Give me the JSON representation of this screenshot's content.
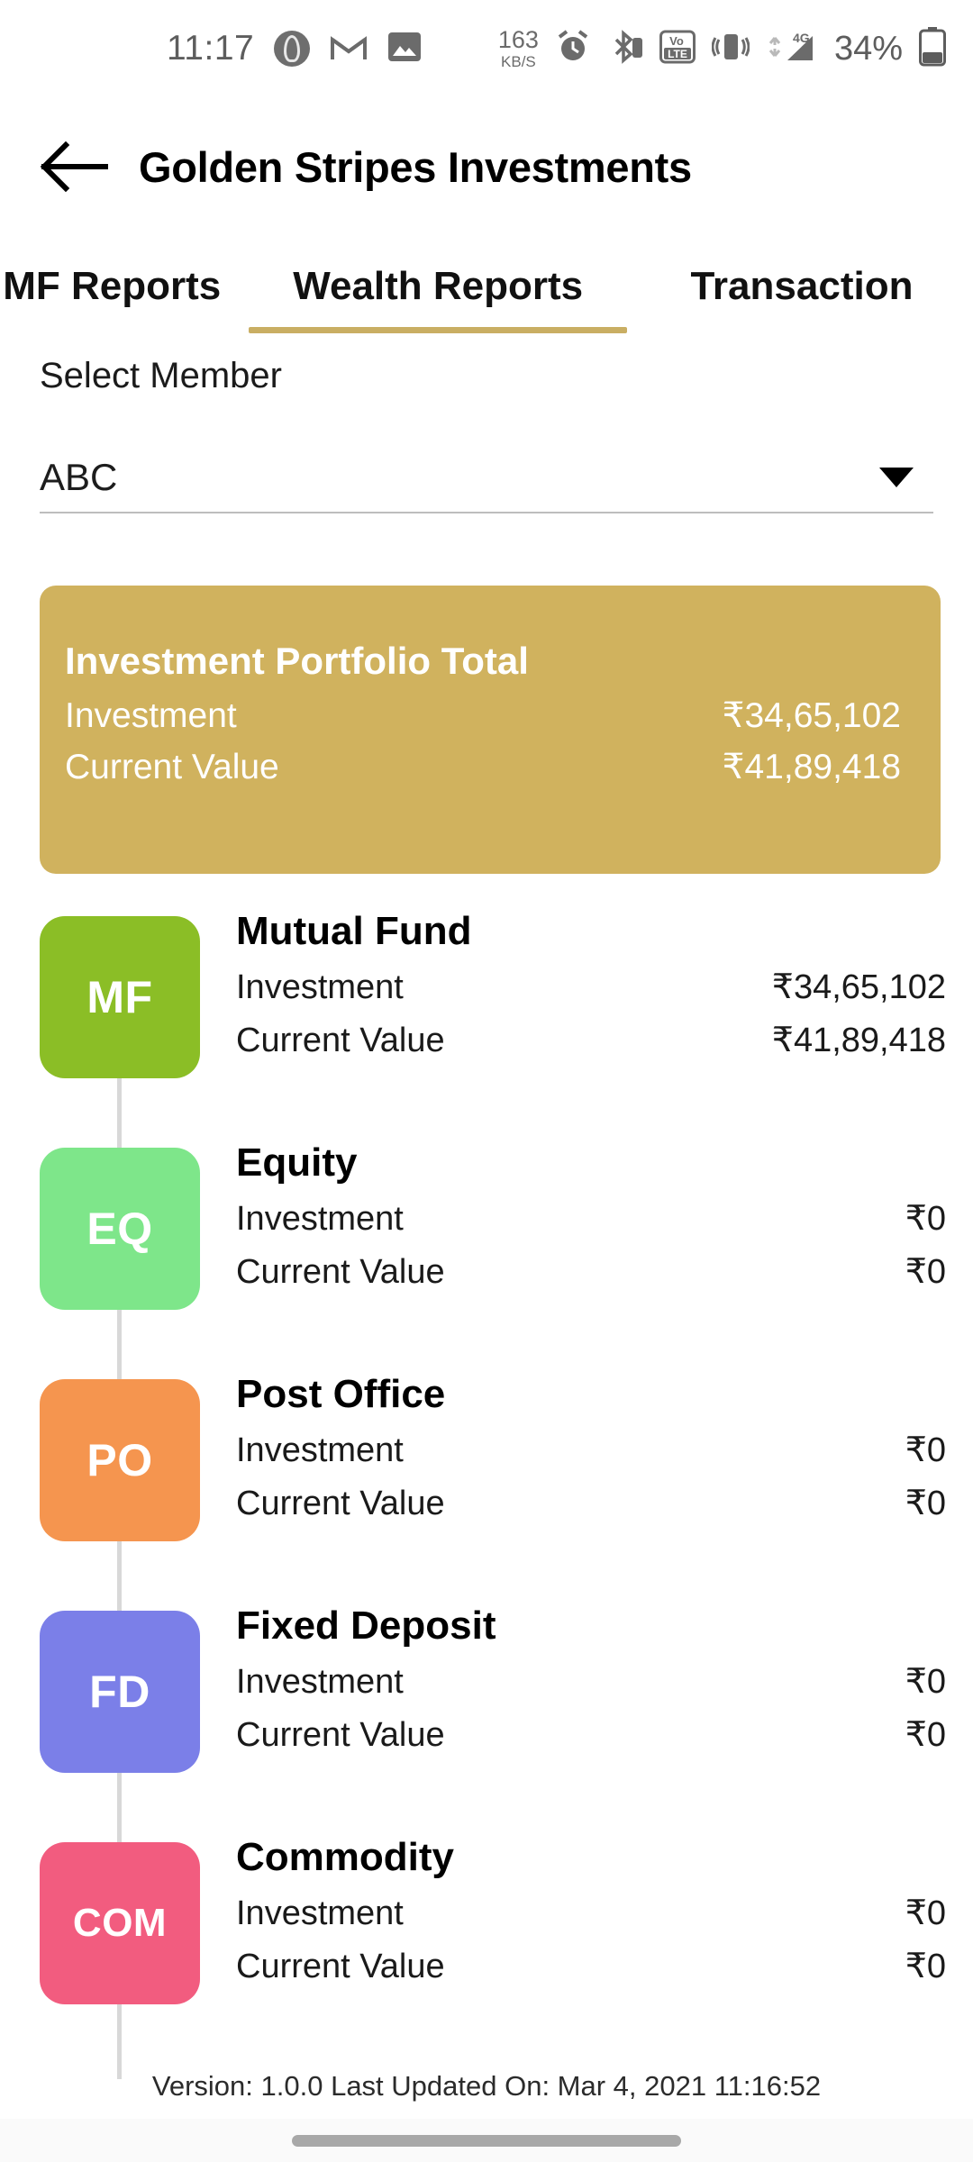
{
  "status_bar": {
    "time": "11:17",
    "network_speed_value": "163",
    "network_speed_unit": "KB/S",
    "battery_percent": "34%",
    "network_type": "4G",
    "volte_top": "Vo",
    "volte_bottom": "LTE",
    "icons": [
      "app-circle-icon",
      "gmail-icon",
      "photos-icon",
      "alarm-icon",
      "bluetooth-icon",
      "volte-icon",
      "vibrate-icon",
      "signal-4g-icon",
      "battery-icon"
    ]
  },
  "appbar": {
    "back_icon": "back-arrow-icon",
    "title": "Golden Stripes Investments"
  },
  "tabs": [
    {
      "label": "MF Reports",
      "active": false
    },
    {
      "label": "Wealth Reports",
      "active": true
    },
    {
      "label": "Transaction",
      "active": false
    }
  ],
  "member_select": {
    "label": "Select Member",
    "value": "ABC",
    "caret_icon": "chevron-down-icon"
  },
  "portfolio_card": {
    "title": "Investment Portfolio Total",
    "investment_label": "Investment",
    "investment_value": "₹34,65,102",
    "current_value_label": "Current Value",
    "current_value": "₹41,89,418",
    "background_color": "#d0b25e"
  },
  "assets": [
    {
      "code": "MF",
      "name": "Mutual Fund",
      "investment_label": "Investment",
      "investment_value": "₹34,65,102",
      "current_value_label": "Current Value",
      "current_value": "₹41,89,418",
      "color": "#8bbe26"
    },
    {
      "code": "EQ",
      "name": "Equity",
      "investment_label": "Investment",
      "investment_value": "₹0",
      "current_value_label": "Current Value",
      "current_value": "₹0",
      "color": "#7ee68a"
    },
    {
      "code": "PO",
      "name": "Post Office",
      "investment_label": "Investment",
      "investment_value": "₹0",
      "current_value_label": "Current Value",
      "current_value": "₹0",
      "color": "#f5954f"
    },
    {
      "code": "FD",
      "name": "Fixed Deposit",
      "investment_label": "Investment",
      "investment_value": "₹0",
      "current_value_label": "Current Value",
      "current_value": "₹0",
      "color": "#7b7fe8"
    },
    {
      "code": "COM",
      "name": "Commodity",
      "investment_label": "Investment",
      "investment_value": "₹0",
      "current_value_label": "Current Value",
      "current_value": "₹0",
      "color": "#f25c7f"
    }
  ],
  "footer": {
    "text": "Version: 1.0.0 Last Updated On: Mar 4, 2021 11:16:52"
  }
}
